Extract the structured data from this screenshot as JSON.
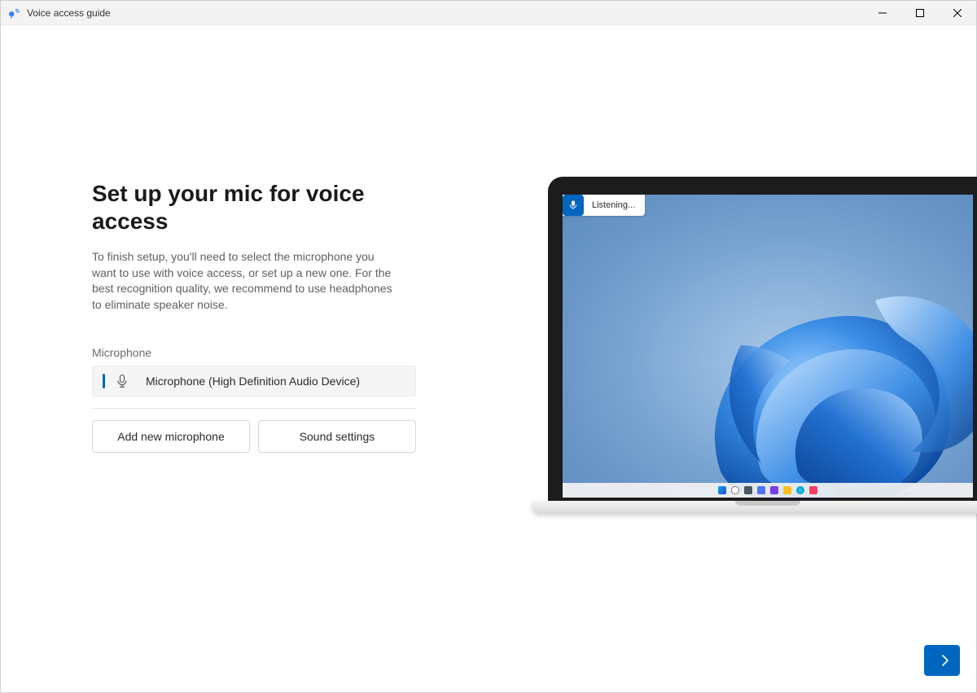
{
  "window": {
    "title": "Voice access guide"
  },
  "main": {
    "heading": "Set up your mic for voice access",
    "description": "To finish setup, you'll need to select the microphone you want to use with voice access, or set up a new one. For the best recognition quality, we recommend to use headphones to eliminate speaker noise.",
    "microphone_label": "Microphone",
    "selected_microphone": "Microphone (High Definition Audio Device)",
    "buttons": {
      "add_mic": "Add new microphone",
      "sound_settings": "Sound settings"
    }
  },
  "preview": {
    "listening_label": "Listening..."
  },
  "colors": {
    "accent": "#0067c0"
  }
}
